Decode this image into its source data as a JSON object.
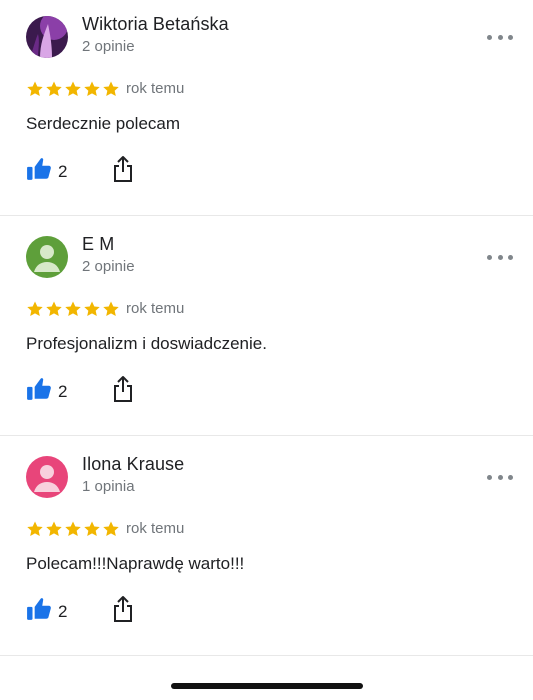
{
  "colors": {
    "star": "#f2b600",
    "like": "#1a73e8",
    "secondary_text": "#70757a"
  },
  "reviews": [
    {
      "author": "Wiktoria Betańska",
      "review_count": "2 opinie",
      "rating": 5,
      "time": "rok temu",
      "text": "Serdecznie polecam",
      "likes": "2",
      "avatar": "photo-avatar"
    },
    {
      "author": "E M",
      "review_count": "2 opinie",
      "rating": 5,
      "time": "rok temu",
      "text": "Profesjonalizm i doswiadczenie.",
      "likes": "2",
      "avatar": "default-avatar-green"
    },
    {
      "author": "Ilona Krause",
      "review_count": "1 opinia",
      "rating": 5,
      "time": "rok temu",
      "text": "Polecam!!!Naprawdę warto!!!",
      "likes": "2",
      "avatar": "default-avatar-pink"
    }
  ]
}
